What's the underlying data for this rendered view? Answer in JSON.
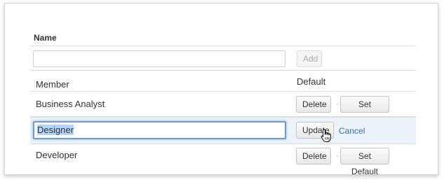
{
  "table": {
    "column_header": "Name",
    "new_row": {
      "input_value": "",
      "input_placeholder": "",
      "add_label": "Add"
    },
    "rows": [
      {
        "name": "Member",
        "status": "Default"
      },
      {
        "name": "Business Analyst",
        "delete_label": "Delete",
        "separator": "·",
        "set_default_label": "Set Default"
      },
      {
        "name": "Designer",
        "update_label": "Update",
        "cancel_label": "Cancel"
      },
      {
        "name": "Developer",
        "delete_label": "Delete",
        "separator": "·",
        "set_default_label": "Set Default"
      }
    ]
  },
  "colors": {
    "link": "#3572b0",
    "editing_row_bg": "#ebf2f9",
    "focus_border": "#6e9bd2"
  },
  "icons": {
    "cursor": "hand-pointer-icon"
  }
}
